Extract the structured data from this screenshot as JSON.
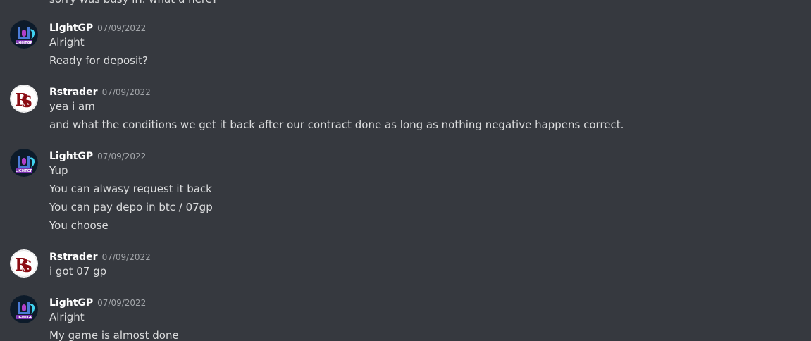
{
  "colors": {
    "background": "#36393f",
    "username": "#ffffff",
    "message_text": "#dcddde",
    "timestamp": "#a3a6aa",
    "rstrader_avatar_red": "#8b0d14",
    "lightgp_avatar_dark": "#0d1b2a",
    "lightgp_avatar_cyan": "#3fd3f0",
    "lightgp_avatar_magenta": "#b13fc8"
  },
  "partial_top_message": "sorry was busy irl. what u here?",
  "messages": [
    {
      "author": "LightGP",
      "avatar_icon": "lightgp-logo-avatar",
      "timestamp": "07/09/2022",
      "lines": [
        "Alright",
        "Ready for deposit?"
      ]
    },
    {
      "author": "Rstrader",
      "avatar_icon": "rs-logo-avatar",
      "timestamp": "07/09/2022",
      "lines": [
        "yea i am",
        "and what the conditions we get it back after our contract done as long as nothing negative happens correct."
      ]
    },
    {
      "author": "LightGP",
      "avatar_icon": "lightgp-logo-avatar",
      "timestamp": "07/09/2022",
      "lines": [
        "Yup",
        "You can alwasy request it back",
        "You can pay depo in btc / 07gp",
        "You choose"
      ]
    },
    {
      "author": "Rstrader",
      "avatar_icon": "rs-logo-avatar",
      "timestamp": "07/09/2022",
      "lines": [
        "i got 07 gp"
      ]
    },
    {
      "author": "LightGP",
      "avatar_icon": "lightgp-logo-avatar",
      "timestamp": "07/09/2022",
      "lines": [
        "Alright",
        "My game is almost done"
      ]
    }
  ]
}
